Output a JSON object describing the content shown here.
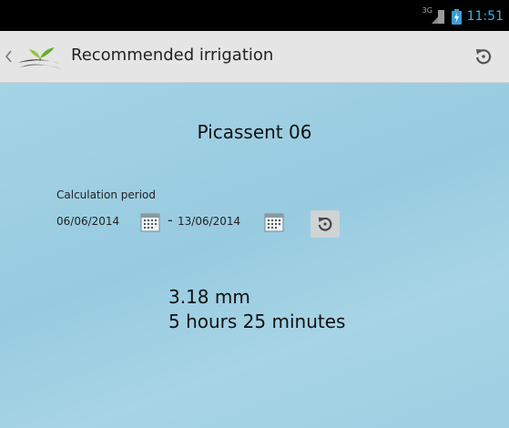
{
  "status_bar": {
    "network_label": "3G",
    "time": "11:51",
    "icons": [
      "signal-icon",
      "battery-icon"
    ]
  },
  "action_bar": {
    "title": "Recommended irrigation",
    "icons": [
      "up-caret-icon",
      "sprout-logo-icon",
      "refresh-icon"
    ]
  },
  "main": {
    "plot_name": "Picassent 06",
    "period_label": "Calculation period",
    "date_from": "06/06/2014",
    "date_separator": "-",
    "date_to": "13/06/2014",
    "result_amount": "3.18 mm",
    "result_duration": "5 hours 25 minutes"
  },
  "colors": {
    "status_bar_bg": "#000000",
    "time_color": "#33b5e5",
    "action_bar_bg": "#e5e5e5",
    "content_bg": "#9fcfe2"
  }
}
